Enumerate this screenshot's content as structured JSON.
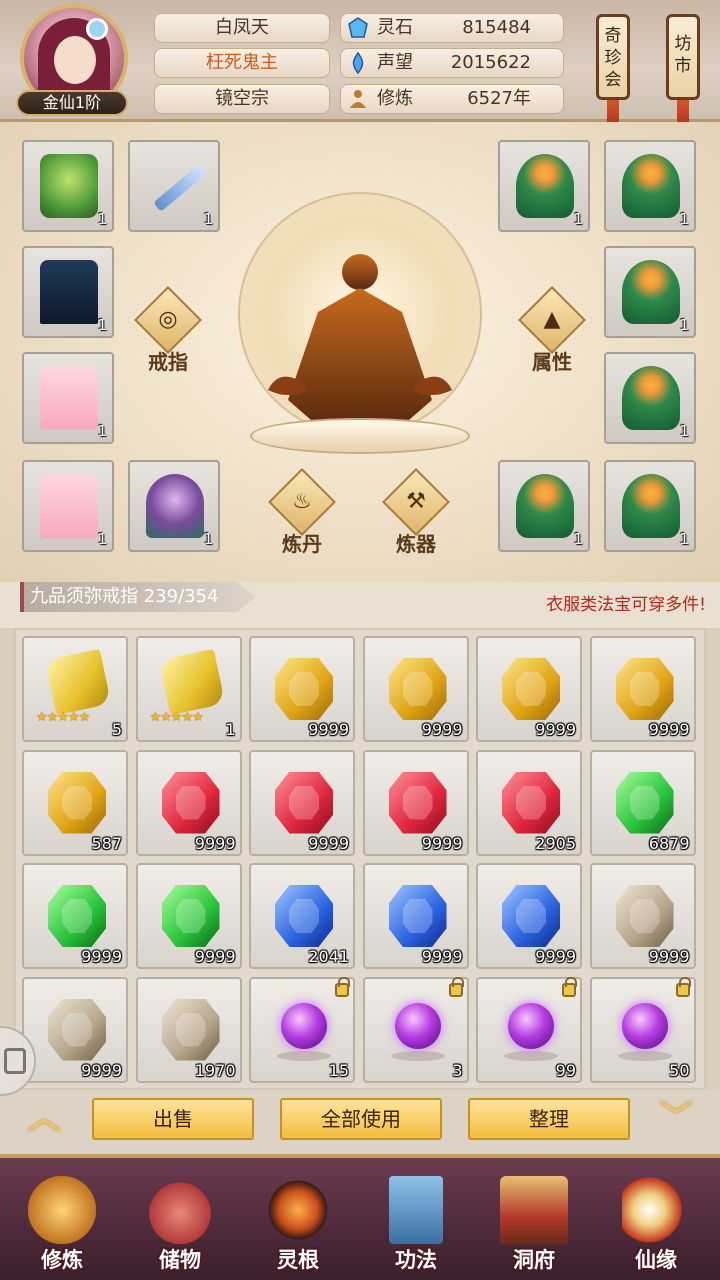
{
  "player": {
    "rank": "金仙1阶",
    "name": "白凤天",
    "title": "枉死鬼主",
    "sect": "镜空宗"
  },
  "stats": [
    {
      "label": "灵石",
      "value": "815484",
      "icon": "spirit-stone-icon"
    },
    {
      "label": "声望",
      "value": "2015622",
      "icon": "reputation-icon"
    },
    {
      "label": "修炼",
      "value": "6527年",
      "icon": "cultivation-icon"
    }
  ],
  "top_buttons": {
    "treasure": "奇珍会",
    "market": "坊市"
  },
  "equipment": {
    "left_slots": [
      {
        "item": "green-robe",
        "count": "1"
      },
      {
        "item": "ice-sword",
        "count": "1"
      },
      {
        "item": "dark-robe",
        "count": "1"
      },
      {
        "item": "pink-robe",
        "count": "1"
      },
      {
        "item": "pink-robe",
        "count": "1"
      },
      {
        "item": "fairy-robe",
        "count": "1"
      }
    ],
    "right_slots": [
      {
        "item": "leaf-robe",
        "count": "1"
      },
      {
        "item": "leaf-robe",
        "count": "1"
      },
      {
        "item": "leaf-robe",
        "count": "1"
      },
      {
        "item": "leaf-robe",
        "count": "1"
      },
      {
        "item": "leaf-robe",
        "count": "1"
      },
      {
        "item": "leaf-robe",
        "count": "1"
      }
    ],
    "buttons": {
      "ring": "戒指",
      "attributes": "属性",
      "alchemy": "炼丹",
      "forge": "炼器"
    }
  },
  "ring_bar": {
    "ring_name": "九品须弥戒指 239/354",
    "notice": "衣服类法宝可穿多件!"
  },
  "inventory": [
    {
      "type": "scroll",
      "count": "5",
      "stars": "★★★★★"
    },
    {
      "type": "scroll",
      "count": "1",
      "stars": "★★★★★"
    },
    {
      "type": "yellow",
      "count": "9999"
    },
    {
      "type": "yellow",
      "count": "9999"
    },
    {
      "type": "yellow",
      "count": "9999"
    },
    {
      "type": "yellow",
      "count": "9999"
    },
    {
      "type": "yellow",
      "count": "587"
    },
    {
      "type": "red",
      "count": "9999"
    },
    {
      "type": "red",
      "count": "9999"
    },
    {
      "type": "red",
      "count": "9999"
    },
    {
      "type": "red",
      "count": "2905"
    },
    {
      "type": "green",
      "count": "6879"
    },
    {
      "type": "green",
      "count": "9999"
    },
    {
      "type": "green",
      "count": "9999"
    },
    {
      "type": "blue",
      "count": "2041"
    },
    {
      "type": "blue",
      "count": "9999"
    },
    {
      "type": "blue",
      "count": "9999"
    },
    {
      "type": "grey",
      "count": "9999"
    },
    {
      "type": "grey",
      "count": "9999"
    },
    {
      "type": "grey",
      "count": "1970"
    },
    {
      "type": "orb",
      "count": "15",
      "locked": true
    },
    {
      "type": "orb",
      "count": "3",
      "locked": true
    },
    {
      "type": "orb",
      "count": "99",
      "locked": true
    },
    {
      "type": "orb",
      "count": "50",
      "locked": true
    }
  ],
  "actions": {
    "sell": "出售",
    "use_all": "全部使用",
    "organize": "整理",
    "up": "︿",
    "down": "﹀"
  },
  "nav": [
    {
      "label": "修炼",
      "icon": "cultivate-icon"
    },
    {
      "label": "储物",
      "icon": "storage-bag-icon"
    },
    {
      "label": "灵根",
      "icon": "spirit-root-icon"
    },
    {
      "label": "功法",
      "icon": "skill-book-icon"
    },
    {
      "label": "洞府",
      "icon": "cave-dwelling-icon"
    },
    {
      "label": "仙缘",
      "icon": "immortal-fate-icon"
    }
  ],
  "colors": {
    "accent_gold": "#f3bd3e",
    "notice_red": "#b8261a",
    "title_orange": "#d2591c",
    "nav_bg": "#3b1f2c"
  }
}
